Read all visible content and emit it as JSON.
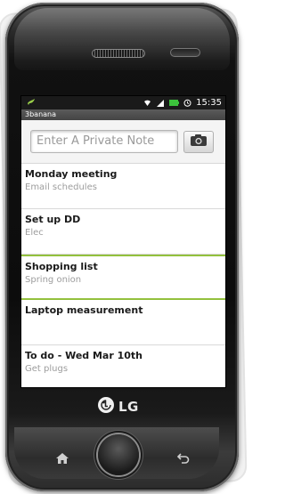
{
  "status": {
    "time": "15:35",
    "icons": [
      "notification-bird-icon",
      "wifi-icon",
      "signal-icon",
      "battery-icon",
      "alarm-icon"
    ]
  },
  "app": {
    "title": "3banana"
  },
  "note_entry": {
    "placeholder": "Enter A Private Note",
    "camera_icon": "camera-icon"
  },
  "notes": [
    {
      "title": "Monday meeting",
      "subtitle": "Email schedules"
    },
    {
      "title": "Set up DD",
      "subtitle": "Elec"
    },
    {
      "title": "Shopping list",
      "subtitle": "Spring onion"
    },
    {
      "title": "Laptop measurement",
      "subtitle": ""
    },
    {
      "title": "To do - Wed Mar 10th",
      "subtitle": "Get plugs"
    }
  ],
  "device": {
    "brand": "LG",
    "keys": [
      "home-icon",
      "center-key",
      "back-icon"
    ]
  },
  "colors": {
    "highlight": "#93c13d",
    "statusbar": "#1a1a1a",
    "titlebar": "#4d4d4d"
  }
}
